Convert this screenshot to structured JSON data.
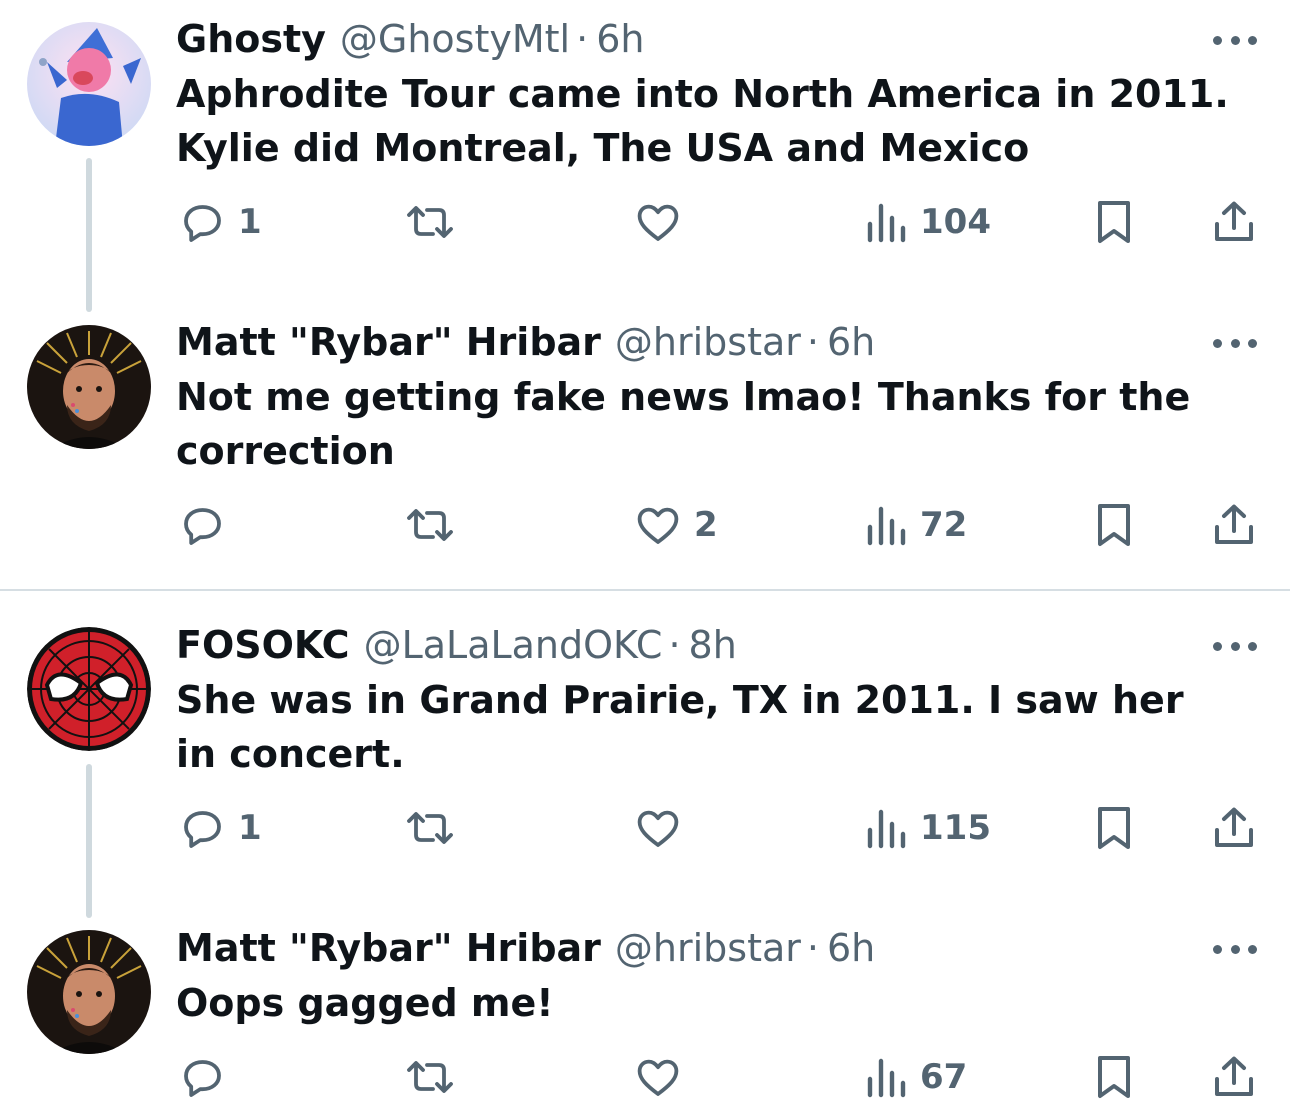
{
  "tweets": [
    {
      "name": "Ghosty",
      "handle": "@GhostyMtl",
      "separator": "·",
      "time": "6h",
      "text": "Aphrodite Tour came into North America in 2011. Kylie did Montreal, The USA and Mexico",
      "replies": "1",
      "retweets": "",
      "likes": "",
      "views": "104",
      "avatar": "cartoon-character-avatar"
    },
    {
      "name": "Matt \"Rybar\" Hribar",
      "handle": "@hribstar",
      "separator": "·",
      "time": "6h",
      "text": "Not me getting fake news lmao! Thanks for the correction",
      "replies": "",
      "retweets": "",
      "likes": "2",
      "views": "72",
      "avatar": "bearded-man-halo-avatar"
    },
    {
      "name": "FOSOKC",
      "handle": "@LaLaLandOKC",
      "separator": "·",
      "time": "8h",
      "text": "She was in Grand Prairie, TX in 2011. I saw her in concert.",
      "replies": "1",
      "retweets": "",
      "likes": "",
      "views": "115",
      "avatar": "spiderman-mask-avatar"
    },
    {
      "name": "Matt \"Rybar\" Hribar",
      "handle": "@hribstar",
      "separator": "·",
      "time": "6h",
      "text": "Oops gagged me!",
      "replies": "",
      "retweets": "",
      "likes": "",
      "views": "67",
      "avatar": "bearded-man-halo-avatar"
    }
  ],
  "colors": {
    "text_primary": "#0f1419",
    "text_secondary": "#536471",
    "thread_line": "#cfd9de",
    "divider": "#d6dee3",
    "spiderman_red": "#d0202a"
  },
  "icons": [
    "reply-icon",
    "retweet-icon",
    "like-icon",
    "views-icon",
    "bookmark-icon",
    "share-icon",
    "more-icon"
  ]
}
